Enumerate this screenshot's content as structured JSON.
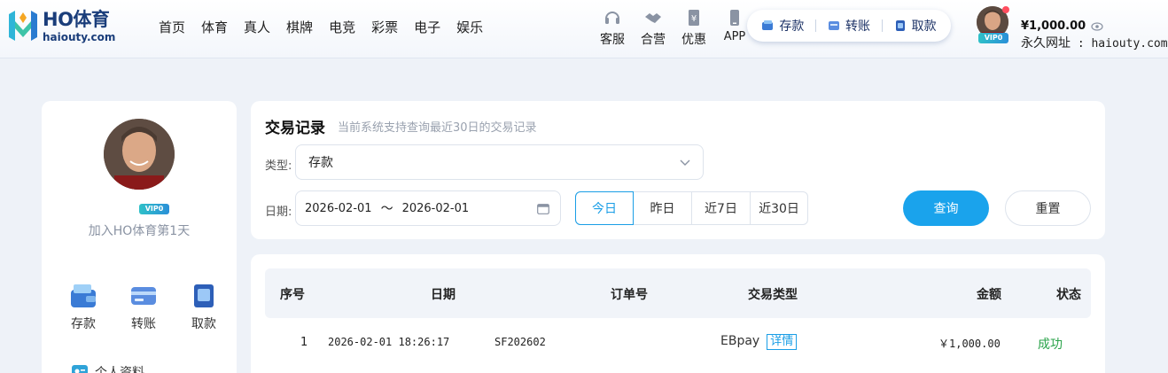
{
  "brand": {
    "name": "HO体育",
    "domain": "haiouty.com",
    "colors": {
      "primary": "#1aa3ec",
      "navy": "#1a3d7a",
      "success": "#2aa34a"
    }
  },
  "nav": {
    "items": [
      {
        "label": "首页"
      },
      {
        "label": "体育"
      },
      {
        "label": "真人"
      },
      {
        "label": "棋牌"
      },
      {
        "label": "电竞"
      },
      {
        "label": "彩票"
      },
      {
        "label": "电子"
      },
      {
        "label": "娱乐"
      }
    ]
  },
  "tools": {
    "service": {
      "label": "客服",
      "icon": "headset-icon"
    },
    "partner": {
      "label": "合营",
      "icon": "handshake-icon"
    },
    "promo": {
      "label": "优惠",
      "icon": "coupon-icon"
    },
    "app": {
      "label": "APP",
      "icon": "phone-icon"
    }
  },
  "wallet": {
    "deposit_label": "存款",
    "transfer_label": "转账",
    "withdraw_label": "取款"
  },
  "user": {
    "vip_label": "VIP0",
    "balance": "¥1,000.00",
    "perm_label": "永久网址",
    "perm_url": "haiouty.com"
  },
  "sidebar": {
    "vip_label": "VIP0",
    "join_text": "加入HO体育第1天",
    "actions": {
      "deposit": "存款",
      "transfer": "转账",
      "withdraw": "取款"
    },
    "profile_label": "个人资料"
  },
  "filter": {
    "title": "交易记录",
    "subtitle": "当前系统支持查询最近30日的交易记录",
    "type_label": "类型:",
    "type_value": "存款",
    "date_label": "日期:",
    "date_start": "2026-02-01",
    "date_sep": "〜",
    "date_end": "2026-02-01",
    "quick": {
      "today": "今日",
      "yesterday": "昨日",
      "last7": "近7日",
      "last30": "近30日"
    },
    "query_label": "查询",
    "reset_label": "重置"
  },
  "table": {
    "headers": {
      "index": "序号",
      "date": "日期",
      "order": "订单号",
      "type": "交易类型",
      "amount": "金额",
      "status": "状态"
    },
    "rows": [
      {
        "index": "1",
        "date": "2026-02-01 18:26:17",
        "order": "SF202602",
        "type": "EBpay",
        "detail": "详情",
        "amount": "￥1,000.00",
        "status": "成功"
      }
    ]
  }
}
